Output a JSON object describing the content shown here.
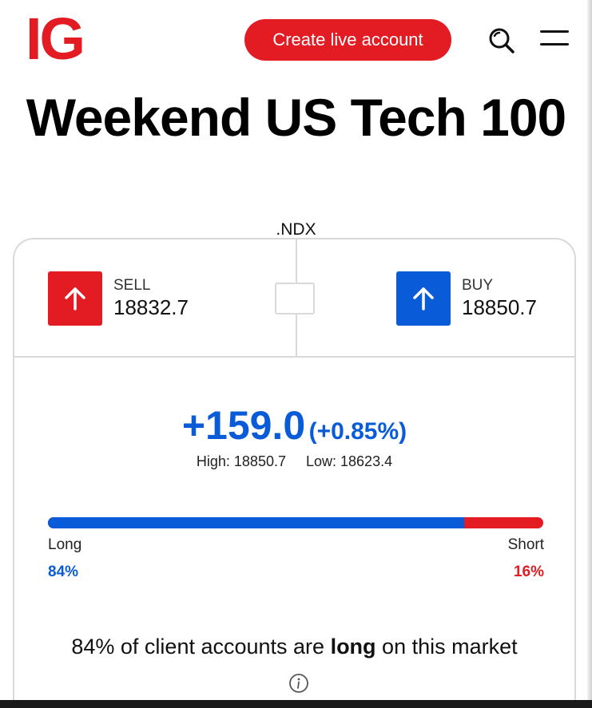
{
  "header": {
    "logo_text": "IG",
    "cta_label": "Create live account",
    "search_icon": "search-icon",
    "menu_icon": "hamburger-menu-icon"
  },
  "market": {
    "title": "Weekend US Tech 100",
    "ticker": ".NDX"
  },
  "deal": {
    "sell_label": "SELL",
    "sell_price": "18832.7",
    "buy_label": "BUY",
    "buy_price": "18850.7",
    "arrow_icon": "arrow-up-icon"
  },
  "change": {
    "value": "+159.0",
    "percent": "(+0.85%)",
    "high": "High: 18850.7",
    "low": "Low: 18623.4"
  },
  "sentiment": {
    "long_label": "Long",
    "short_label": "Short",
    "long_pct_text": "84%",
    "short_pct_text": "16%",
    "long_fraction": 0.84,
    "message_prefix": "84% of client accounts are ",
    "message_bold": "long",
    "message_suffix": " on this market",
    "info_icon": "info-icon"
  },
  "colors": {
    "brand_red": "#e31b23",
    "buy_blue": "#0a5bd8"
  }
}
